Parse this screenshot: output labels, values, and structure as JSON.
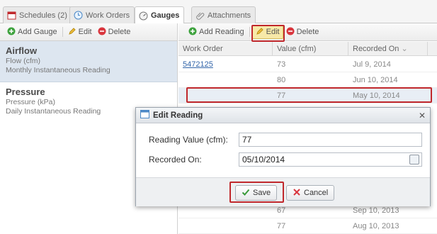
{
  "tabs": [
    {
      "label": "Schedules (2)",
      "icon": "calendar-icon"
    },
    {
      "label": "Work Orders",
      "icon": "clock-icon"
    },
    {
      "label": "Gauges",
      "icon": "gauge-icon"
    },
    {
      "label": "Attachments",
      "icon": "paperclip-icon"
    }
  ],
  "left_toolbar": {
    "add": "Add Gauge",
    "edit": "Edit",
    "delete": "Delete"
  },
  "gauges": [
    {
      "name": "Airflow",
      "unit": "Flow (cfm)",
      "freq": "Monthly Instantaneous Reading"
    },
    {
      "name": "Pressure",
      "unit": "Pressure (kPa)",
      "freq": "Daily Instantaneous Reading"
    }
  ],
  "right_toolbar": {
    "add": "Add Reading",
    "edit": "Edit",
    "delete": "Delete"
  },
  "grid": {
    "headers": {
      "work_order": "Work Order",
      "value": "Value (cfm)",
      "recorded": "Recorded On"
    },
    "rows": [
      {
        "work_order": "5472125",
        "value": "73",
        "recorded": "Jul 9, 2014"
      },
      {
        "work_order": "",
        "value": "80",
        "recorded": "Jun 10, 2014"
      },
      {
        "work_order": "",
        "value": "77",
        "recorded": "May 10, 2014"
      },
      {
        "work_order": "",
        "value": "67",
        "recorded": "Sep 10, 2013"
      },
      {
        "work_order": "",
        "value": "77",
        "recorded": "Aug 10, 2013"
      }
    ]
  },
  "dialog": {
    "title": "Edit Reading",
    "reading_label": "Reading Value (cfm):",
    "reading_value": "77",
    "recorded_label": "Recorded On:",
    "recorded_value": "05/10/2014",
    "save": "Save",
    "cancel": "Cancel"
  },
  "colors": {
    "highlight": "#c0282c",
    "selected_row": "#dde6f0",
    "link": "#3366aa"
  }
}
